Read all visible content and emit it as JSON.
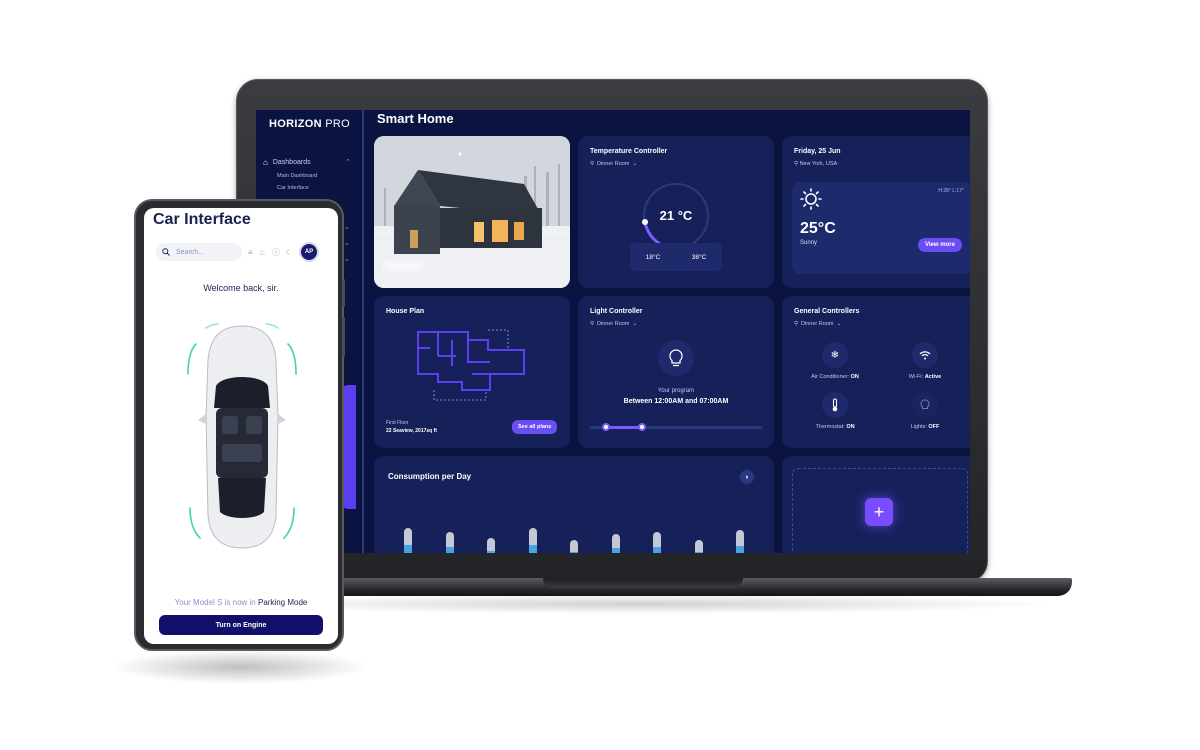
{
  "laptop": {
    "brand_bold": "HORIZON",
    "brand_light": "PRO",
    "sidebar": {
      "dashboards_label": "Dashboards",
      "sub_items": [
        "Main Dashboard",
        "Car Interface"
      ]
    },
    "page_title": "Smart Home",
    "house_card": {
      "photos_label": "More photos"
    },
    "temperature": {
      "title": "Temperature Controller",
      "location": "Dinner Room",
      "current": "21 °C",
      "min": "18°C",
      "max": "38°C"
    },
    "weather": {
      "date": "Friday, 25 Jun",
      "location": "New York, USA",
      "hl": "H:28° L:17°",
      "temp": "25°C",
      "condition": "Sunny",
      "more_label": "View more"
    },
    "house_plan": {
      "title": "House Plan",
      "floor": "First Floor",
      "address": "22 Seaview, 2017sq ft",
      "button": "See all plans"
    },
    "light": {
      "title": "Light Controller",
      "location": "Dinner Room",
      "program_label": "Your program",
      "program_time": "Between 12:00AM and 07:00AM"
    },
    "general": {
      "title": "General Controllers",
      "location": "Dinner Room",
      "controls": [
        {
          "name": "Air Conditioner:",
          "state": "ON",
          "icon": "snowflake-icon"
        },
        {
          "name": "Wi-Fi:",
          "state": "Active",
          "icon": "wifi-icon"
        },
        {
          "name": "Thermostat:",
          "state": "ON",
          "icon": "thermometer-icon"
        },
        {
          "name": "Lights:",
          "state": "OFF",
          "icon": "lightbulb-icon"
        }
      ]
    },
    "consumption": {
      "title": "Consumption per Day"
    }
  },
  "phone": {
    "title": "Car Interface",
    "search_placeholder": "Search...",
    "avatar": "AP",
    "welcome": "Welcome back, sir.",
    "status_prefix": "Your Model S is now in",
    "status_mode": "Parking Mode",
    "engine_button": "Turn on Engine"
  },
  "chart_data": {
    "type": "bar",
    "title": "Consumption per Day",
    "categories": [
      "",
      "",
      "",
      "",
      "",
      "",
      "",
      "",
      ""
    ],
    "values": [
      0.55,
      0.55,
      0.55,
      0.55,
      0.55,
      0.55,
      0.55,
      0.55,
      0.55
    ]
  }
}
